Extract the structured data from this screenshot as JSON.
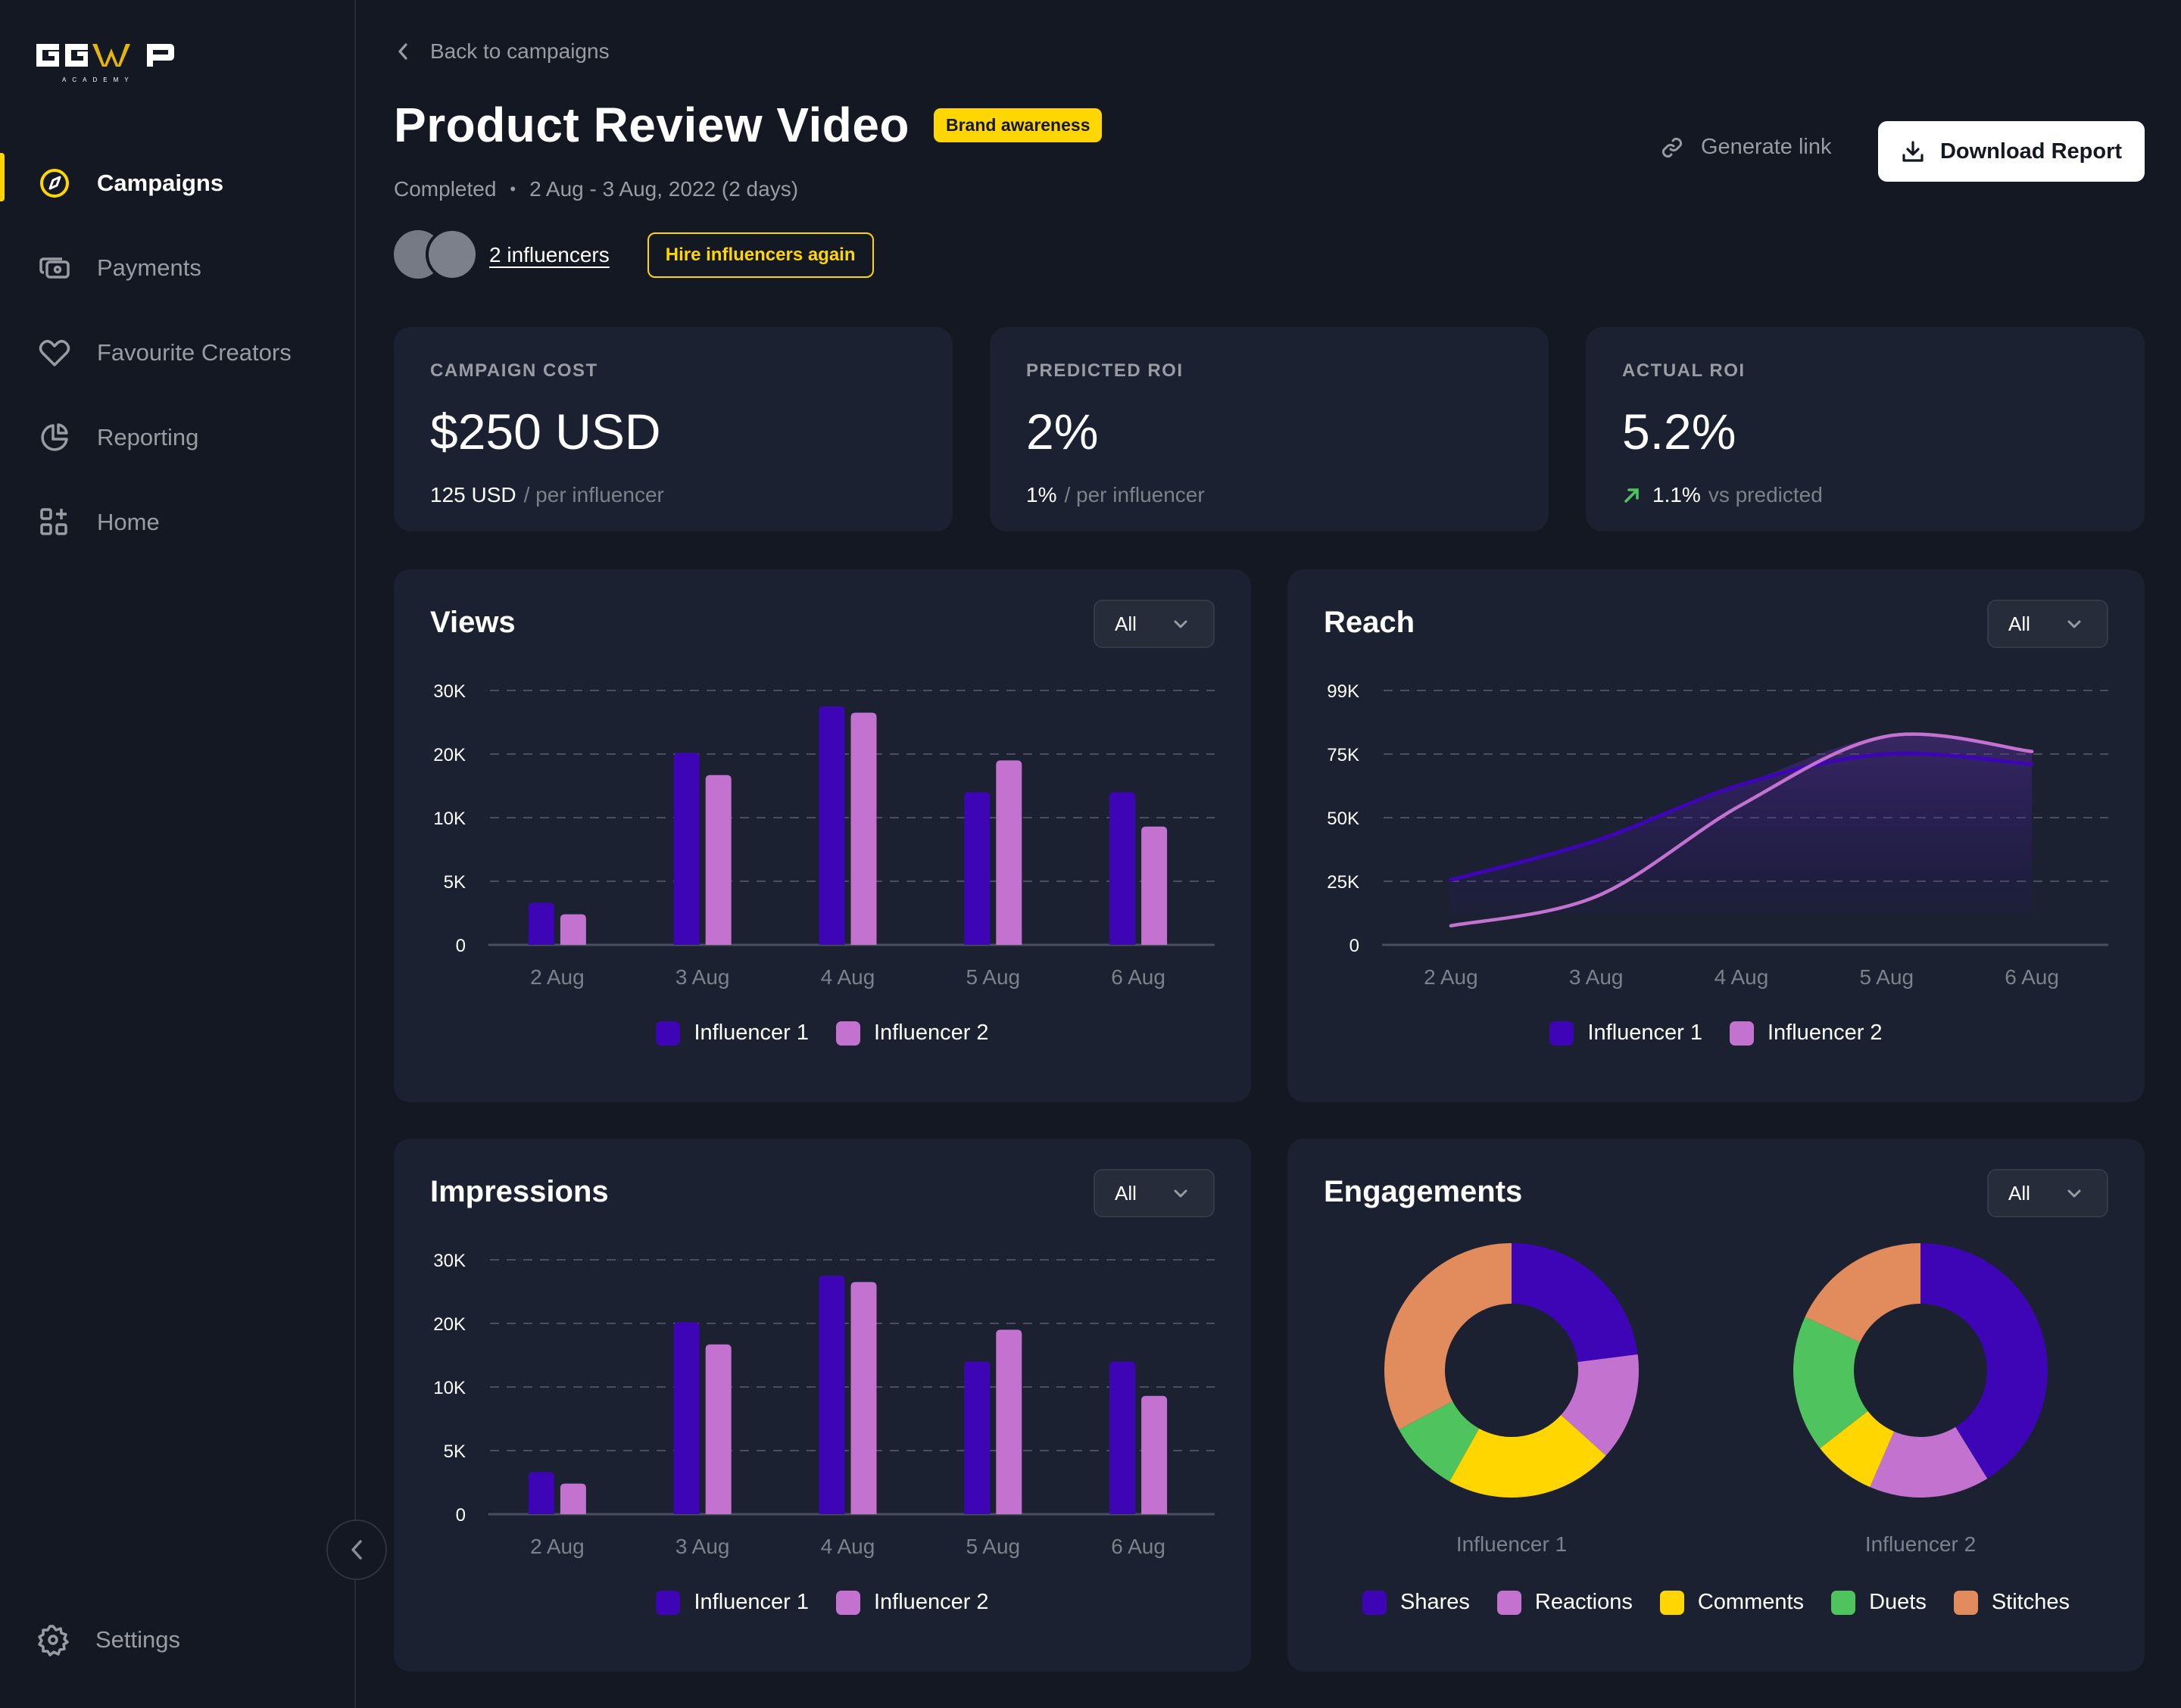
{
  "brand": {
    "name": "GGWP",
    "sub": "ACADEMY",
    "accent": "#ffd600"
  },
  "sidebar": {
    "items": [
      {
        "label": "Campaigns",
        "icon": "compass-icon",
        "active": true
      },
      {
        "label": "Payments",
        "icon": "payments-icon",
        "active": false
      },
      {
        "label": "Favourite Creators",
        "icon": "heart-icon",
        "active": false
      },
      {
        "label": "Reporting",
        "icon": "pie-chart-icon",
        "active": false
      },
      {
        "label": "Home",
        "icon": "grid-plus-icon",
        "active": false
      }
    ],
    "settings": {
      "label": "Settings",
      "icon": "gear-icon"
    },
    "collapse_icon": "chevron-left-icon"
  },
  "header": {
    "back_label": "Back to campaigns",
    "title": "Product Review Video",
    "badge": "Brand awareness",
    "status": "Completed",
    "date_range": "2 Aug - 3 Aug, 2022 (2 days)",
    "influencers_link": "2 influencers",
    "hire_again": "Hire influencers again",
    "generate_link": "Generate link",
    "download_report": "Download Report"
  },
  "stats": [
    {
      "caption": "CAMPAIGN COST",
      "value": "$250 USD",
      "sub_strong": "125 USD",
      "sub_weak": "/ per influencer"
    },
    {
      "caption": "PREDICTED ROI",
      "value": "2%",
      "sub_strong": "1%",
      "sub_weak": "/ per influencer"
    },
    {
      "caption": "ACTUAL ROI",
      "value": "5.2%",
      "sub_strong": "1.1%",
      "sub_weak": "vs predicted",
      "trend": "up",
      "trend_color": "#4fc35d"
    }
  ],
  "colors": {
    "influencer1": "#3d05b5",
    "influencer2": "#c373cf",
    "shares": "#3d05b5",
    "reactions": "#c373cf",
    "comments": "#ffd600",
    "duets": "#4fc35d",
    "stitches": "#e28b5c"
  },
  "filters": {
    "selected": "All"
  },
  "chart_data": [
    {
      "id": "views",
      "type": "bar",
      "title": "Views",
      "categories": [
        "2 Aug",
        "3 Aug",
        "4 Aug",
        "5 Aug",
        "6 Aug"
      ],
      "yticks": [
        0,
        5000,
        10000,
        20000,
        30000
      ],
      "ytick_labels": [
        "0",
        "5K",
        "10K",
        "20K",
        "30K"
      ],
      "series": [
        {
          "name": "Influencer 1",
          "values": [
            3300,
            20200,
            27500,
            14000,
            14000
          ]
        },
        {
          "name": "Influencer 2",
          "values": [
            2400,
            16700,
            26500,
            19000,
            9300
          ]
        }
      ],
      "grid": true,
      "legend": "bottom-center"
    },
    {
      "id": "reach",
      "type": "area",
      "title": "Reach",
      "categories": [
        "2 Aug",
        "3 Aug",
        "4 Aug",
        "5 Aug",
        "6 Aug"
      ],
      "yticks": [
        0,
        25000,
        50000,
        75000,
        99000
      ],
      "ytick_labels": [
        "0",
        "25K",
        "50K",
        "75K",
        "99K"
      ],
      "ylim": [
        0,
        100000
      ],
      "series": [
        {
          "name": "Influencer 1",
          "values": [
            25500,
            41000,
            63000,
            75000,
            71000
          ]
        },
        {
          "name": "Influencer 2",
          "values": [
            7500,
            19000,
            55000,
            82000,
            76000
          ]
        }
      ],
      "grid": true,
      "legend": "bottom-center"
    },
    {
      "id": "impressions",
      "type": "bar",
      "title": "Impressions",
      "categories": [
        "2 Aug",
        "3 Aug",
        "4 Aug",
        "5 Aug",
        "6 Aug"
      ],
      "yticks": [
        0,
        5000,
        10000,
        20000,
        30000
      ],
      "ytick_labels": [
        "0",
        "5K",
        "10K",
        "20K",
        "30K"
      ],
      "series": [
        {
          "name": "Influencer 1",
          "values": [
            3300,
            20200,
            27500,
            14000,
            14000
          ]
        },
        {
          "name": "Influencer 2",
          "values": [
            2400,
            16700,
            26500,
            19000,
            9300
          ]
        }
      ],
      "grid": true,
      "legend": "bottom-center"
    },
    {
      "id": "engagements",
      "type": "pie",
      "title": "Engagements",
      "categories": [
        "Shares",
        "Reactions",
        "Comments",
        "Duets",
        "Stitches"
      ],
      "series": [
        {
          "name": "Influencer 1",
          "values": [
            23.0,
            13.7,
            21.4,
            9.2,
            32.7
          ]
        },
        {
          "name": "Influencer 2",
          "values": [
            41.2,
            15.3,
            8.0,
            17.4,
            18.1
          ]
        }
      ],
      "legend": "bottom-center"
    }
  ]
}
